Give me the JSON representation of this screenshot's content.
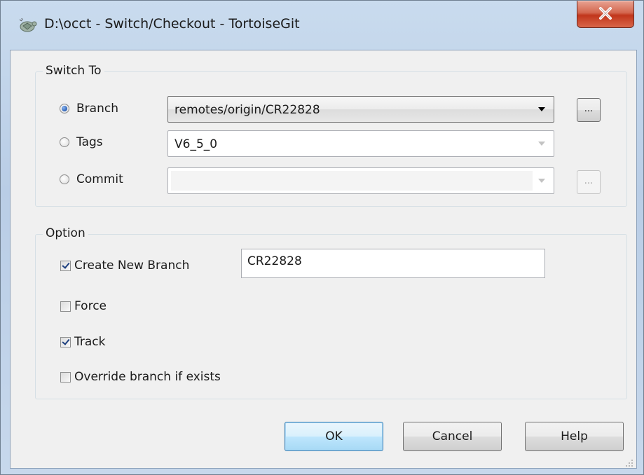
{
  "window": {
    "title": "D:\\occt - Switch/Checkout - TortoiseGit",
    "close_icon": "close-icon",
    "app_icon": "tortoisegit-icon"
  },
  "switch_to": {
    "group_label": "Switch To",
    "branch": {
      "label": "Branch",
      "selected": true,
      "value": "remotes/origin/CR22828",
      "browse_label": "..."
    },
    "tags": {
      "label": "Tags",
      "selected": false,
      "value": "V6_5_0"
    },
    "commit": {
      "label": "Commit",
      "selected": false,
      "value": "",
      "browse_label": "..."
    }
  },
  "option": {
    "group_label": "Option",
    "create_new_branch": {
      "label": "Create New Branch",
      "checked": true,
      "value": "CR22828"
    },
    "force": {
      "label": "Force",
      "checked": false
    },
    "track": {
      "label": "Track",
      "checked": true
    },
    "override": {
      "label": "Override branch if exists",
      "checked": false
    }
  },
  "buttons": {
    "ok": "OK",
    "cancel": "Cancel",
    "help": "Help"
  }
}
